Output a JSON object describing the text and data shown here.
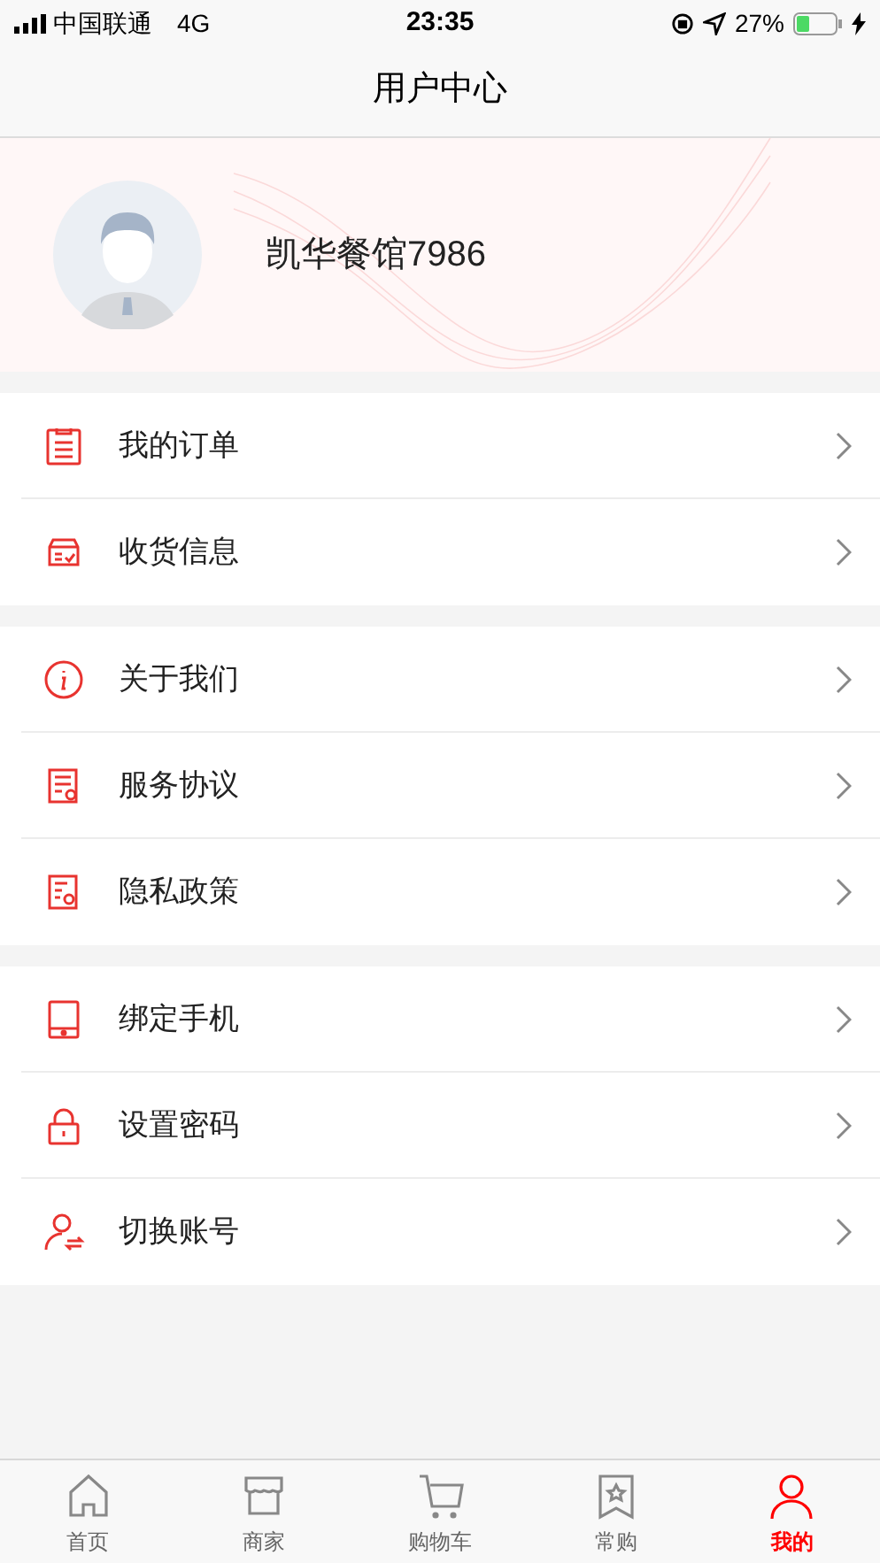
{
  "status_bar": {
    "carrier": "中国联通",
    "network": "4G",
    "time": "23:35",
    "battery": "27%"
  },
  "nav": {
    "title": "用户中心"
  },
  "profile": {
    "name": "凯华餐馆7986"
  },
  "menu_groups": [
    [
      {
        "kind": "order",
        "label": "我的订单"
      },
      {
        "kind": "address",
        "label": "收货信息"
      }
    ],
    [
      {
        "kind": "info",
        "label": "关于我们"
      },
      {
        "kind": "agreement",
        "label": "服务协议"
      },
      {
        "kind": "privacy",
        "label": "隐私政策"
      }
    ],
    [
      {
        "kind": "phone",
        "label": "绑定手机"
      },
      {
        "kind": "lock",
        "label": "设置密码"
      },
      {
        "kind": "switch",
        "label": "切换账号"
      }
    ]
  ],
  "tabs": [
    {
      "kind": "home",
      "label": "首页",
      "selected": false
    },
    {
      "kind": "store",
      "label": "商家",
      "selected": false
    },
    {
      "kind": "cart",
      "label": "购物车",
      "selected": false
    },
    {
      "kind": "favorite",
      "label": "常购",
      "selected": false
    },
    {
      "kind": "user",
      "label": "我的",
      "selected": true
    }
  ]
}
